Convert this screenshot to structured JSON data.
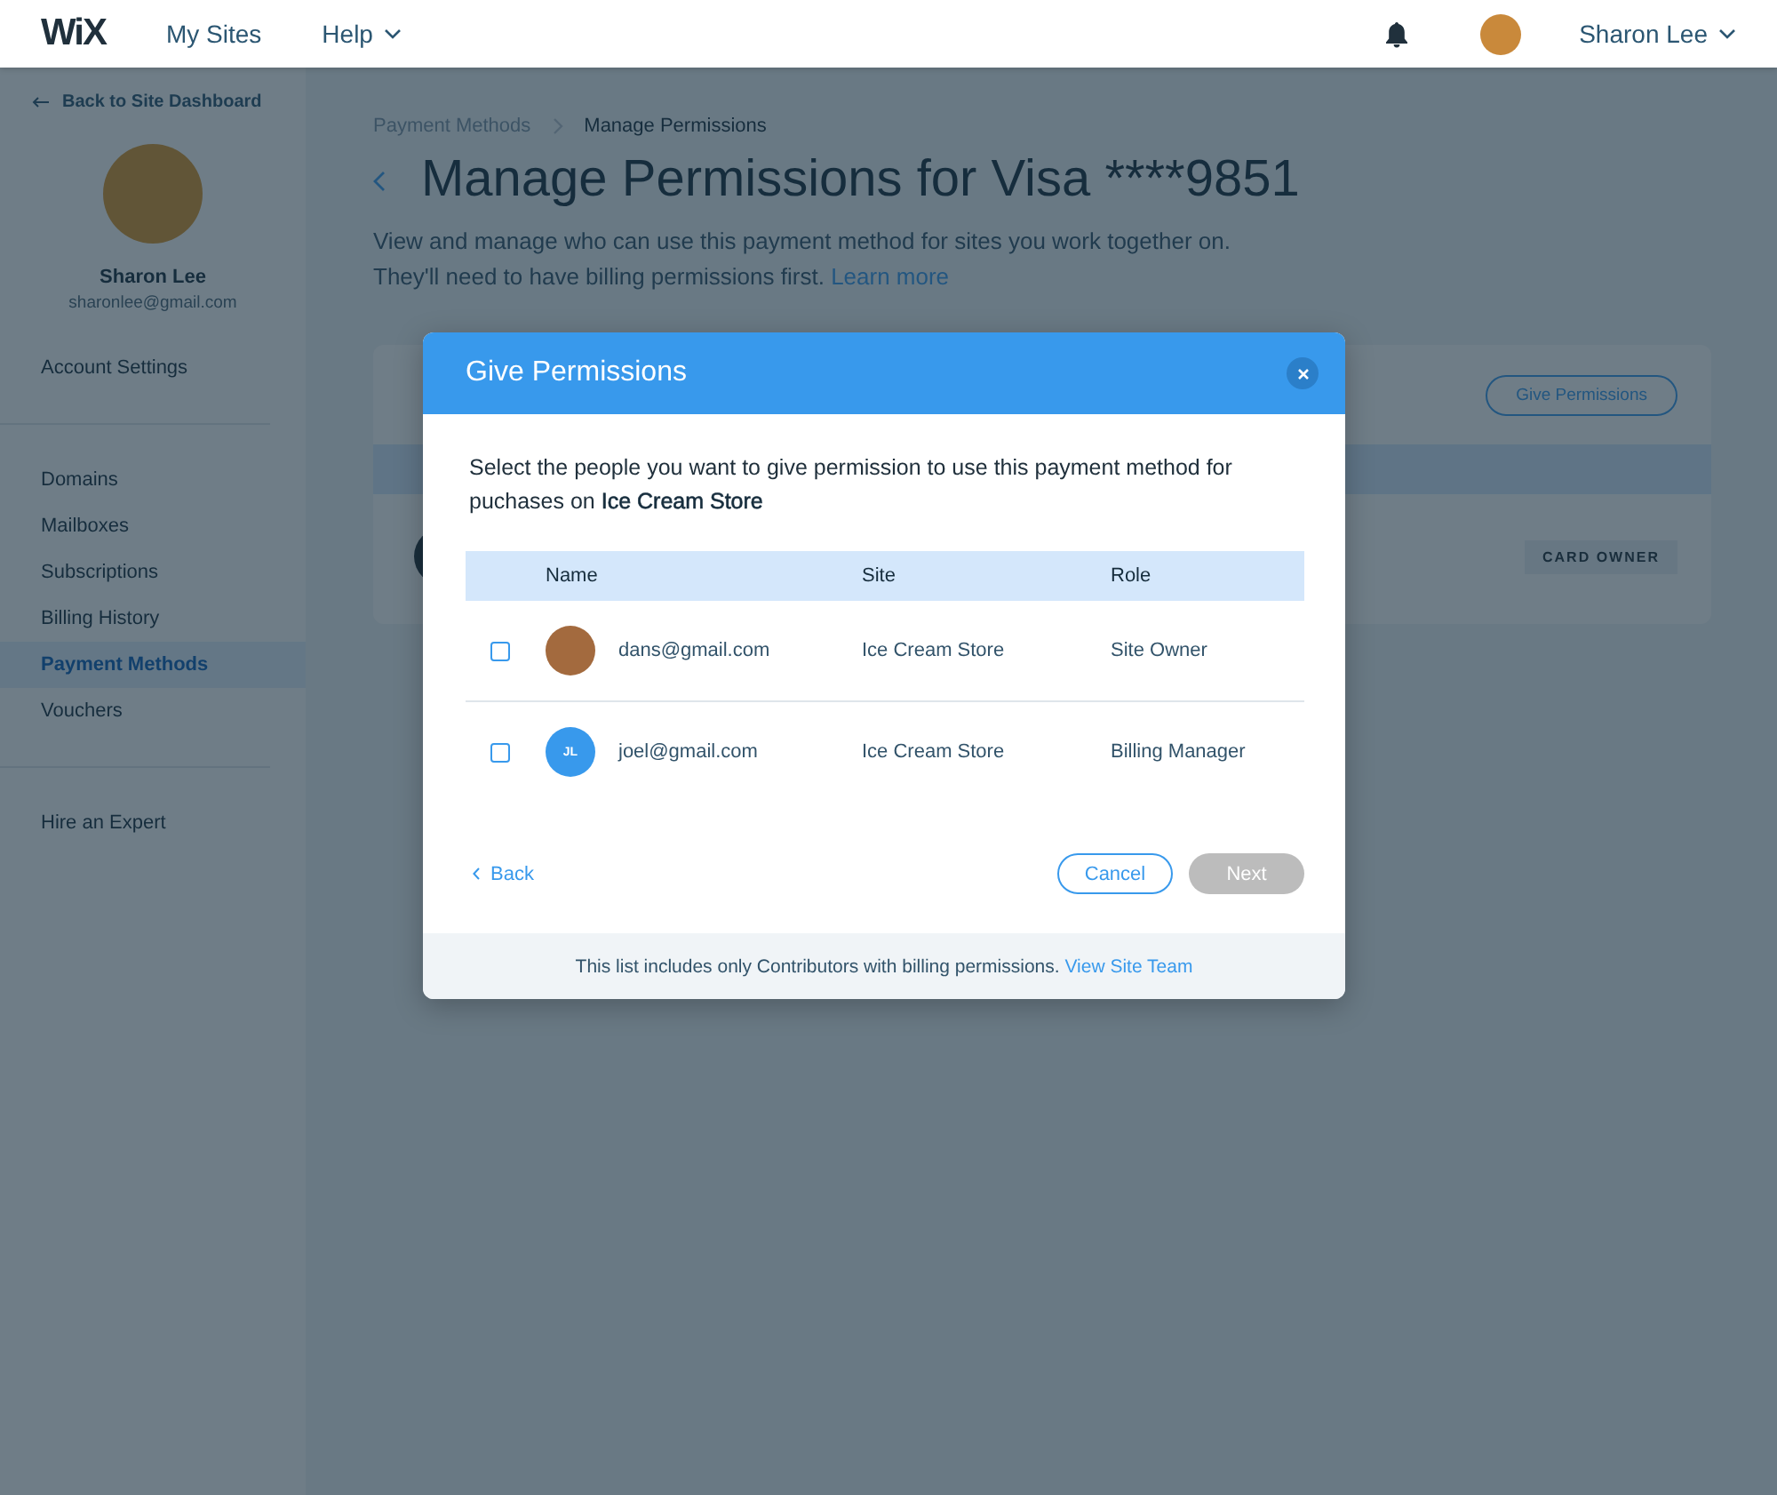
{
  "topbar": {
    "logo": "WiX",
    "nav": [
      {
        "label": "My Sites",
        "has_menu": false
      },
      {
        "label": "Help",
        "has_menu": true
      }
    ],
    "user_name": "Sharon Lee"
  },
  "sidebar": {
    "back_link": "Back to Site Dashboard",
    "profile": {
      "name": "Sharon Lee",
      "email": "sharonlee@gmail.com"
    },
    "groups": [
      [
        {
          "label": "Account Settings",
          "selected": false
        }
      ],
      [
        {
          "label": "Domains",
          "selected": false
        },
        {
          "label": "Mailboxes",
          "selected": false
        },
        {
          "label": "Subscriptions",
          "selected": false
        },
        {
          "label": "Billing History",
          "selected": false
        },
        {
          "label": "Payment Methods",
          "selected": true
        },
        {
          "label": "Vouchers",
          "selected": false
        }
      ],
      [
        {
          "label": "Hire an Expert",
          "selected": false
        }
      ]
    ]
  },
  "main": {
    "breadcrumbs": [
      "Payment Methods",
      "Manage Permissions"
    ],
    "title": "Manage Permissions for Visa ****9851",
    "description_lines": [
      "View and manage who can use this payment method for sites you work together on.",
      "They'll need to have billing permissions first."
    ],
    "learn_more": "Learn more",
    "card": {
      "give_permissions_button": "Give Permissions",
      "badge": "CARD OWNER"
    }
  },
  "dialog": {
    "title": "Give Permissions",
    "intro": "Select the people you want to give permission to use this payment method for puchases on **Ice Cream Store**",
    "columns": [
      "Name",
      "Site",
      "Role"
    ],
    "rows": [
      {
        "checked": false,
        "avatar": {
          "kind": "photo"
        },
        "email": "dans@gmail.com",
        "site": "Ice Cream Store",
        "role": "Site Owner"
      },
      {
        "checked": false,
        "avatar": {
          "kind": "initials",
          "initials": "JL"
        },
        "email": "joel@gmail.com",
        "site": "Ice Cream Store",
        "role": "Billing Manager"
      }
    ],
    "back": "Back",
    "cancel": "Cancel",
    "next": {
      "label": "Next",
      "disabled": true
    },
    "footer_note": "This list includes only Contributors with billing permissions.",
    "footer_link": "View Site Team"
  }
}
